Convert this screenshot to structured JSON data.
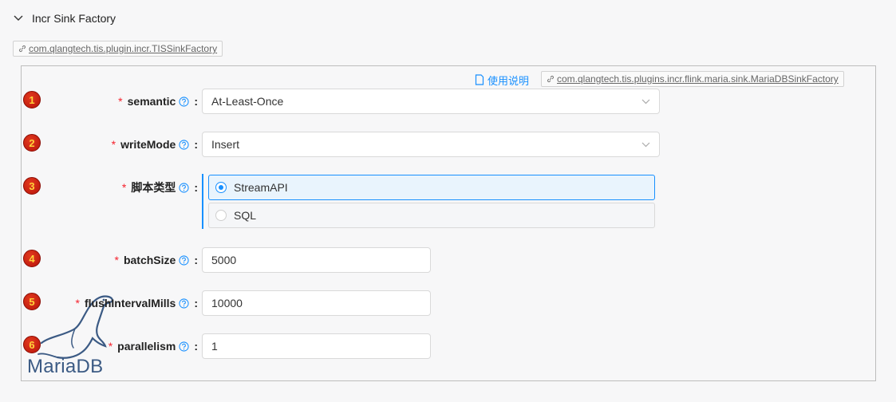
{
  "header": {
    "title": "Incr Sink Factory"
  },
  "outer_tag": {
    "text": "com.qlangtech.tis.plugin.incr.TISSinkFactory"
  },
  "panel": {
    "doc_link": "使用说明",
    "inner_tag": "com.qlangtech.tis.plugins.incr.flink.maria.sink.MariaDBSinkFactory"
  },
  "fields": [
    {
      "badge": "1",
      "label": "semantic",
      "value": "At-Least-Once"
    },
    {
      "badge": "2",
      "label": "writeMode",
      "value": "Insert"
    },
    {
      "badge": "3",
      "label": "脚本类型",
      "options": [
        "StreamAPI",
        "SQL"
      ],
      "selected": "StreamAPI"
    },
    {
      "badge": "4",
      "label": "batchSize",
      "value": "5000"
    },
    {
      "badge": "5",
      "label": "flushIntervalMills",
      "value": "10000"
    },
    {
      "badge": "6",
      "label": "parallelism",
      "value": "1"
    }
  ],
  "required_mark": "*",
  "colon": ":",
  "logo": {
    "text": "MariaDB"
  },
  "colors": {
    "accent": "#1890ff",
    "required": "#f5222d",
    "badge": "#c41a0e",
    "logo": "#3b5a84"
  }
}
